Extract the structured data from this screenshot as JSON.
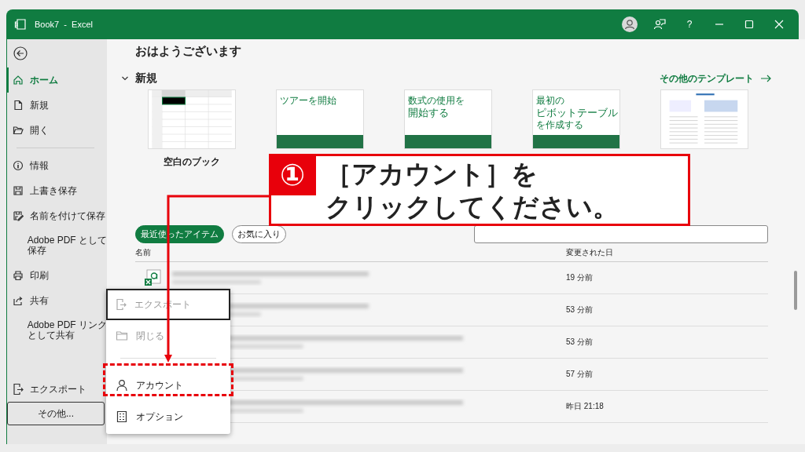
{
  "window": {
    "title": "Book7 - Excel"
  },
  "titlebar_buttons": [
    {
      "kind": "account"
    },
    {
      "kind": "feedback"
    },
    {
      "kind": "help",
      "label": "?"
    },
    {
      "kind": "minimize"
    },
    {
      "kind": "maximize"
    },
    {
      "kind": "close"
    }
  ],
  "sidebar": {
    "groups": [
      [
        {
          "label": "ホーム",
          "selected": true
        },
        {
          "label": "新規",
          "selected": false
        },
        {
          "label": "開く",
          "selected": false
        }
      ],
      [
        {
          "label": "情報",
          "selected": false
        },
        {
          "label": "上書き保存",
          "selected": false
        },
        {
          "label": "名前を付けて保存",
          "selected": false
        },
        {
          "lines": [
            "Adobe PDF として",
            "保存"
          ],
          "selected": false
        },
        {
          "label": "印刷",
          "selected": false
        },
        {
          "label": "共有",
          "selected": false
        },
        {
          "lines": [
            "Adobe PDF リンク",
            "として共有"
          ],
          "selected": false
        }
      ],
      [
        {
          "label": "エクスポート",
          "selected": false
        }
      ]
    ],
    "more": "その他..."
  },
  "home": {
    "greeting": "おはようございます",
    "new_section": {
      "title": "新規",
      "expanded": true,
      "more_templates": "その他のテンプレート"
    },
    "templates": [
      {
        "kind": "blank",
        "label": "空白のブック"
      },
      {
        "kind": "cover",
        "lines": [
          {
            "text": "ツアーを開始",
            "large": false
          }
        ]
      },
      {
        "kind": "cover",
        "lines": [
          {
            "text": "数式の使用を",
            "large": false
          },
          {
            "text": "開始する",
            "large": true
          }
        ]
      },
      {
        "kind": "cover",
        "lines": [
          {
            "text": "最初の",
            "large": false
          },
          {
            "text": "ピボットテーブル",
            "large": true
          },
          {
            "text": "を作成する",
            "large": false
          }
        ]
      },
      {
        "kind": "budget"
      }
    ],
    "filters": [
      {
        "label": "最近使ったアイテム",
        "selected": true
      },
      {
        "label": "お気に入り",
        "selected": false
      }
    ],
    "files": {
      "columns": [
        "名前",
        "変更された日"
      ],
      "rows": [
        {
          "modified": "19 分前"
        },
        {
          "modified": "53 分前"
        },
        {
          "modified": "53 分前"
        },
        {
          "modified": "57 分前"
        },
        {
          "modified": "昨日 21:18"
        }
      ]
    }
  },
  "menu": {
    "groups": [
      [
        {
          "label": "エクスポート",
          "disabled": true,
          "focused": true
        },
        {
          "label": "閉じる",
          "disabled": true,
          "focused": false
        }
      ],
      [
        {
          "label": "アカウント",
          "disabled": false,
          "focused": false
        },
        {
          "label": "オプション",
          "disabled": false,
          "focused": false
        }
      ]
    ]
  },
  "callout": {
    "number": "①",
    "lines": [
      "［アカウント］を",
      "クリックしてください。"
    ]
  }
}
